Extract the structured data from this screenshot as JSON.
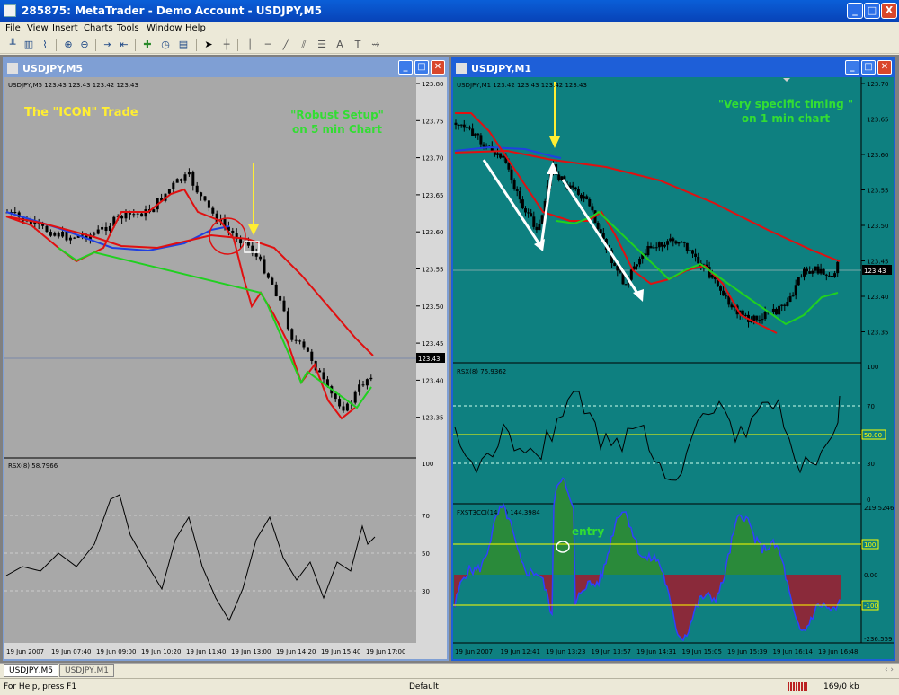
{
  "app": {
    "title": "285875: MetaTrader - Demo Account - USDJPY,M5",
    "window_buttons": [
      "_",
      "□",
      "X"
    ]
  },
  "menu": [
    "File",
    "View",
    "Insert",
    "Charts",
    "Tools",
    "Window",
    "Help"
  ],
  "toolbar_icons": [
    "bar-chart-icon",
    "candle-chart-icon",
    "line-chart-icon",
    "zoom-in-icon",
    "zoom-out-icon",
    "chart-shift-icon",
    "autoscroll-icon",
    "indicators-icon",
    "periods-icon",
    "templates-icon",
    "cursor-icon",
    "crosshair-icon",
    "vertical-line-icon",
    "horizontal-line-icon",
    "trendline-icon",
    "channel-icon",
    "fibonacci-icon",
    "text-icon",
    "label-icon",
    "arrows-icon"
  ],
  "charts": {
    "left": {
      "window_title": "USDJPY,M5",
      "header": "USDJPY,M5  123.43 123.43 123.42 123.43",
      "annotation_title": "The \"ICON\" Trade",
      "annotation_setup_1": "\"Robust Setup\"",
      "annotation_setup_2": "on 5 min Chart",
      "price_ticks": [
        "123.80",
        "123.75",
        "123.70",
        "123.65",
        "123.60",
        "123.55",
        "123.50",
        "123.45",
        "123.40",
        "123.35"
      ],
      "current_price": "123.43",
      "rsx_label": "RSX(8) 58.7966",
      "rsx_ticks": [
        "100",
        "70",
        "50",
        "30"
      ],
      "time_labels": [
        "19 Jun 2007",
        "19 Jun 07:40",
        "19 Jun 09:00",
        "19 Jun 10:20",
        "19 Jun 11:40",
        "19 Jun 13:00",
        "19 Jun 14:20",
        "19 Jun 15:40",
        "19 Jun 17:00"
      ]
    },
    "right": {
      "window_title": "USDJPY,M1",
      "header": "USDJPY,M1  123.42 123.43 123.42 123.43",
      "annotation_timing_1": "\"Very specific timing \"",
      "annotation_timing_2": "on 1 min chart",
      "price_ticks": [
        "123.70",
        "123.65",
        "123.60",
        "123.55",
        "123.50",
        "123.45",
        "123.40",
        "123.35"
      ],
      "current_price": "123.43",
      "rsx_label": "RSX(8) 75.9362",
      "rsx_ticks": [
        "100",
        "70",
        "30",
        "0"
      ],
      "rsx_mid": "50.00",
      "cci_label": "FXST3CCI(14, 5) 144.3984",
      "cci_ticks_top": "219.5246",
      "cci_ticks_zero": "0.00",
      "cci_ticks_bottom": "-236.559",
      "cci_upper": "100",
      "cci_lower": "-100",
      "entry_label": "entry",
      "time_labels": [
        "19 Jun 2007",
        "19 Jun 12:41",
        "19 Jun 13:23",
        "19 Jun 13:57",
        "19 Jun 14:31",
        "19 Jun 15:05",
        "19 Jun 15:39",
        "19 Jun 16:14",
        "19 Jun 16:48"
      ]
    }
  },
  "tabs": [
    "USDJPY,M5",
    "USDJPY,M1"
  ],
  "status": {
    "help": "For Help, press F1",
    "profile": "Default",
    "traffic": "169/0 kb"
  },
  "colors": {
    "left_bg": "#a8a8a8",
    "right_bg": "#0e8080",
    "ma_red": "#e01010",
    "ma_blue": "#2040e0",
    "ma_green": "#20d020",
    "annot_yellow": "#ffee33",
    "annot_green": "#33dd33"
  }
}
